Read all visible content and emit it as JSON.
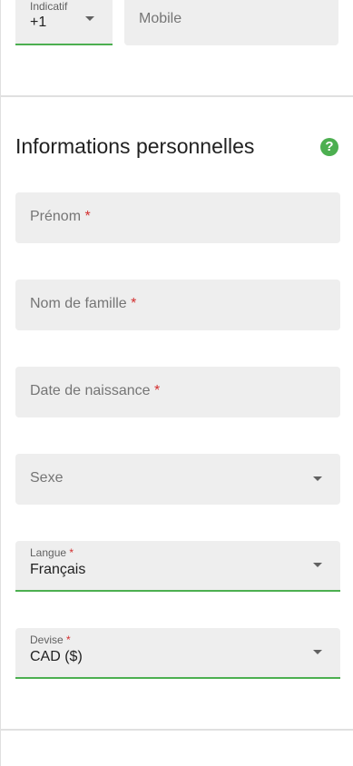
{
  "phone": {
    "indicatif_label": "Indicatif",
    "indicatif_value": "+1",
    "mobile_placeholder": "Mobile"
  },
  "section": {
    "title": "Informations personnelles",
    "help_icon": "?"
  },
  "fields": {
    "prenom": {
      "label": "Prénom",
      "required": "*"
    },
    "nom": {
      "label": "Nom de famille",
      "required": "*"
    },
    "naissance": {
      "label": "Date de naissance",
      "required": "*"
    },
    "sexe": {
      "label": "Sexe"
    },
    "langue": {
      "label": "Langue",
      "required": "*",
      "value": "Français"
    },
    "devise": {
      "label": "Devise",
      "required": "*",
      "value": "CAD ($)"
    }
  },
  "colors": {
    "accent": "#4caf50",
    "required": "#d32f2f",
    "field_bg": "#eeeeee"
  },
  "icons": [
    "chevron-down-icon",
    "help-icon"
  ]
}
